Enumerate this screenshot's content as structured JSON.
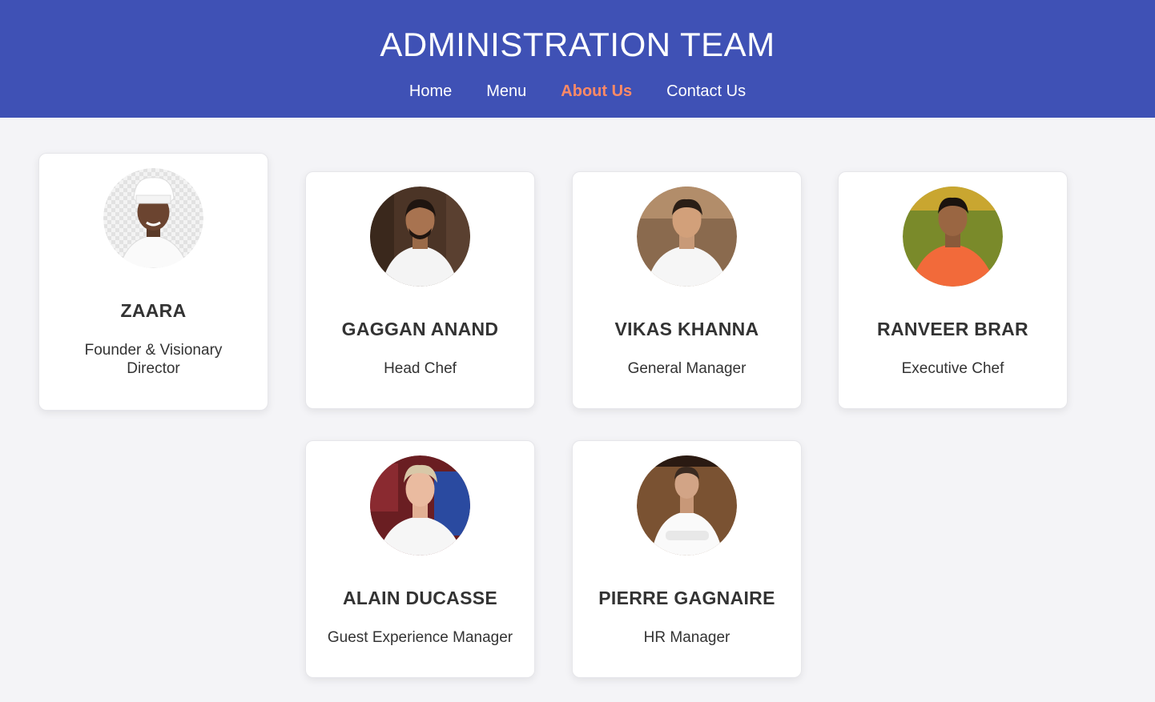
{
  "header": {
    "title": "ADMINISTRATION TEAM",
    "nav": [
      {
        "label": "Home",
        "active": false
      },
      {
        "label": "Menu",
        "active": false
      },
      {
        "label": "About Us",
        "active": true
      },
      {
        "label": "Contact Us",
        "active": false
      }
    ]
  },
  "team": [
    {
      "name": "ZAARA",
      "role": "Founder & Visionary Director"
    },
    {
      "name": "GAGGAN ANAND",
      "role": "Head Chef"
    },
    {
      "name": "VIKAS KHANNA",
      "role": "General Manager"
    },
    {
      "name": "RANVEER BRAR",
      "role": "Executive Chef"
    },
    {
      "name": "ALAIN DUCASSE",
      "role": "Guest Experience Manager"
    },
    {
      "name": "PIERRE GAGNAIRE",
      "role": "HR Manager"
    }
  ],
  "colors": {
    "header_bg": "#3f51b5",
    "active_link": "#ff8a65",
    "page_bg": "#f4f4f7"
  }
}
